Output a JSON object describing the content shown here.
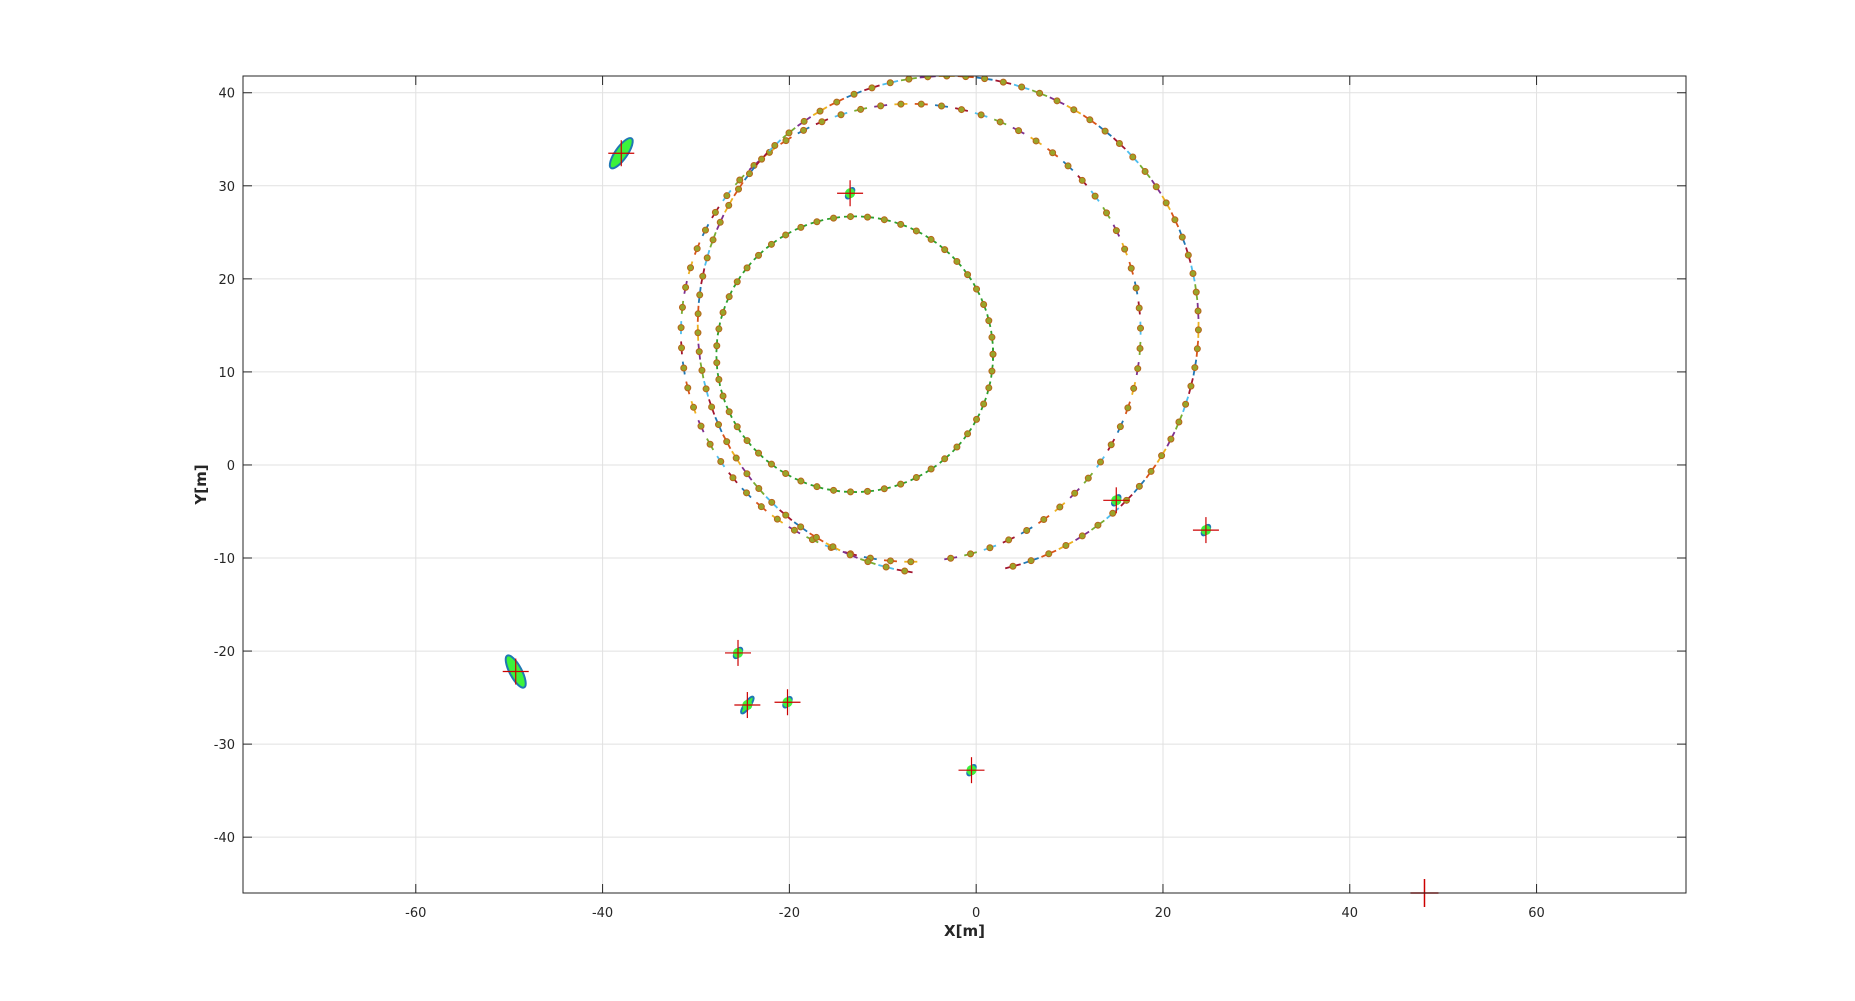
{
  "chart_data": {
    "type": "scatter",
    "xlabel": "X[m]",
    "ylabel": "Y[m]",
    "xlim": [
      -78.5,
      76
    ],
    "ylim": [
      -46,
      41.8
    ],
    "xticks": [
      -60,
      -40,
      -20,
      0,
      20,
      40,
      60
    ],
    "yticks": [
      -40,
      -30,
      -20,
      -10,
      0,
      10,
      20,
      30,
      40
    ],
    "xtick_labels": [
      "-60",
      "-40",
      "-20",
      "0",
      "20",
      "40",
      "60"
    ],
    "ytick_labels": [
      "-40",
      "-30",
      "-20",
      "-10",
      "0",
      "10",
      "20",
      "30",
      "40"
    ],
    "grid": true,
    "trajectory": [
      {
        "cx": -13,
        "cy": 11.9,
        "r": 14.8,
        "n": 52,
        "from_deg": 0,
        "to_deg": 360
      },
      {
        "cx": -7,
        "cy": 14.2,
        "r": 24.6,
        "n": 70,
        "from_deg": -80,
        "to_deg": 270
      },
      {
        "cx": -3,
        "cy": 15.0,
        "r": 26.8,
        "n": 78,
        "from_deg": -75,
        "to_deg": 260
      }
    ],
    "landmarks": [
      {
        "x": -38,
        "y": 33.5,
        "ellipse": "large"
      },
      {
        "x": -13.5,
        "y": 29.2,
        "ellipse": "small"
      },
      {
        "x": 15,
        "y": -3.8,
        "ellipse": "small"
      },
      {
        "x": 24.6,
        "y": -7,
        "ellipse": "small"
      },
      {
        "x": -49.3,
        "y": -22.2,
        "ellipse": "large"
      },
      {
        "x": -25.5,
        "y": -20.2,
        "ellipse": "small"
      },
      {
        "x": -24.5,
        "y": -25.8,
        "ellipse": "medium"
      },
      {
        "x": -20.2,
        "y": -25.5,
        "ellipse": "small"
      },
      {
        "x": -0.5,
        "y": -32.8,
        "ellipse": "small"
      }
    ],
    "markers": [
      {
        "x": 48,
        "y": -46,
        "kind": "cross"
      }
    ],
    "colors": {
      "trajectory_dot": "#9aa529",
      "trajectory_dot_edge": "#b8641a",
      "trajectory_dash": "#2ca02c",
      "landmark_fill": "#3cf23c",
      "cross": "#cc0000",
      "ellipse_colors": [
        "#1f77b4",
        "#d95319",
        "#edb120",
        "#7e2f8e",
        "#77ac30",
        "#4dbeee",
        "#a2142f"
      ],
      "grid": "#e1e1e1",
      "axes": "#262626"
    }
  }
}
